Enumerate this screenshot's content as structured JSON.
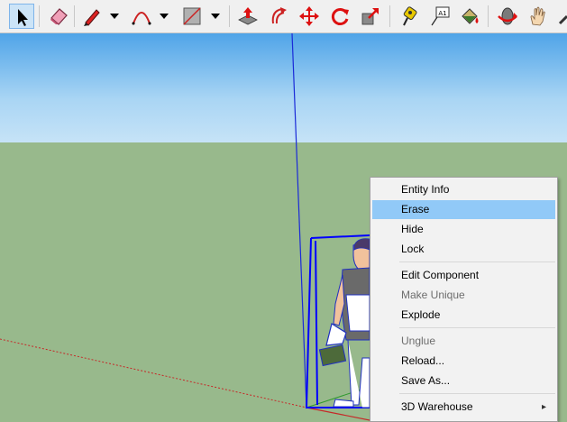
{
  "toolbar": {
    "tools": [
      {
        "name": "select",
        "icon": "select-arrow-icon",
        "active": true
      },
      {
        "name": "eraser",
        "icon": "eraser-icon"
      },
      {
        "name": "line",
        "icon": "pencil-icon",
        "dropdown": true
      },
      {
        "name": "arc",
        "icon": "arc-icon",
        "dropdown": true
      },
      {
        "name": "rectangle",
        "icon": "rectangle-icon",
        "dropdown": true
      },
      {
        "name": "push-pull",
        "icon": "push-pull-icon"
      },
      {
        "name": "offset",
        "icon": "offset-icon"
      },
      {
        "name": "move",
        "icon": "move-icon"
      },
      {
        "name": "rotate",
        "icon": "rotate-icon"
      },
      {
        "name": "scale",
        "icon": "scale-icon"
      },
      {
        "name": "tape-measure",
        "icon": "tape-measure-icon"
      },
      {
        "name": "text",
        "icon": "text-icon",
        "text": "A1"
      },
      {
        "name": "paint-bucket",
        "icon": "paint-bucket-icon"
      },
      {
        "name": "orbit",
        "icon": "orbit-icon"
      },
      {
        "name": "pan",
        "icon": "pan-hand-icon"
      }
    ]
  },
  "colors": {
    "sky_top": "#4fa4e8",
    "sky_bottom": "#c6e3f7",
    "ground": "#98b98c",
    "selection_blue": "#0000ff",
    "menu_highlight": "#91c9f7"
  },
  "context_menu": {
    "items": [
      {
        "label": "Entity Info"
      },
      {
        "label": "Erase",
        "highlighted": true
      },
      {
        "label": "Hide"
      },
      {
        "label": "Lock"
      },
      {
        "label": "Edit Component"
      },
      {
        "label": "Make Unique",
        "disabled": true
      },
      {
        "label": "Explode"
      },
      {
        "label": "Unglue",
        "disabled": true
      },
      {
        "label": "Reload..."
      },
      {
        "label": "Save As..."
      },
      {
        "label": "3D Warehouse",
        "submenu": true
      }
    ]
  }
}
